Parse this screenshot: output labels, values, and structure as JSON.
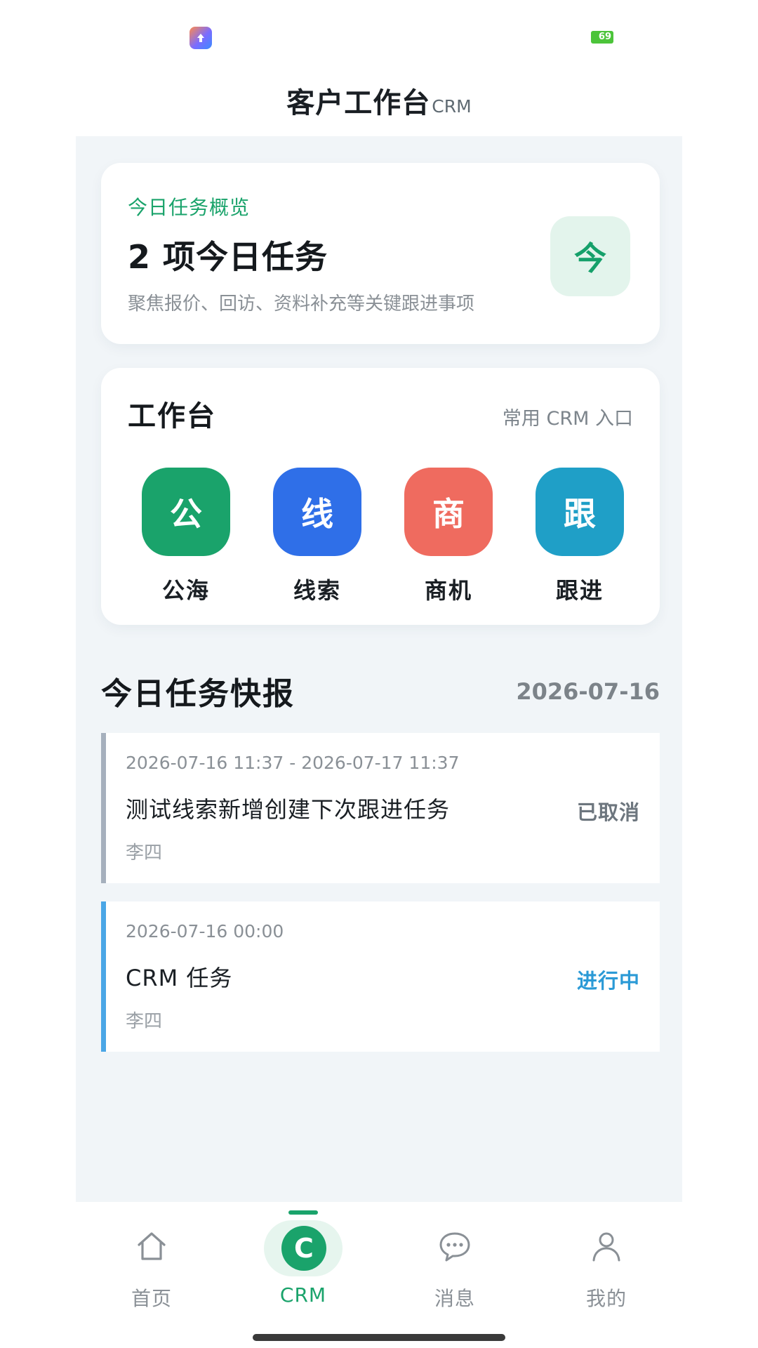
{
  "status_bar": {
    "app_icon": "upload-arrow-icon",
    "battery_level": "69"
  },
  "header": {
    "title": "客户工作台",
    "suffix": "CRM"
  },
  "overview": {
    "kicker": "今日任务概览",
    "title": "2 项今日任务",
    "description": "聚焦报价、回访、资料补充等关键跟进事项",
    "badge": "今",
    "badge_color": "#15a06a"
  },
  "workbench": {
    "title": "工作台",
    "hint": "常用 CRM 入口",
    "entries": [
      {
        "icon_char": "公",
        "label": "公海",
        "color": "#1aa36b"
      },
      {
        "icon_char": "线",
        "label": "线索",
        "color": "#2f6fe8"
      },
      {
        "icon_char": "商",
        "label": "商机",
        "color": "#ef6b5f"
      },
      {
        "icon_char": "跟",
        "label": "跟进",
        "color": "#1f9fc7"
      }
    ]
  },
  "brief": {
    "title": "今日任务快报",
    "date": "2026-07-16",
    "tasks": [
      {
        "time": "2026-07-16 11:37 - 2026-07-17 11:37",
        "title": "测试线索新增创建下次跟进任务",
        "owner": "李四",
        "status": "已取消",
        "status_color": "#6d767e",
        "accent_color": "#a6b0bd"
      },
      {
        "time": "2026-07-16 00:00",
        "title": "CRM 任务",
        "owner": "李四",
        "status": "进行中",
        "status_color": "#2b9ad6",
        "accent_color": "#4aa6e6"
      }
    ]
  },
  "bottom_nav": {
    "active": "CRM",
    "items": [
      {
        "label": "首页",
        "icon": "home-icon"
      },
      {
        "label": "CRM",
        "icon": "crm-icon",
        "icon_char": "C"
      },
      {
        "label": "消息",
        "icon": "chat-bubble-icon"
      },
      {
        "label": "我的",
        "icon": "user-icon"
      }
    ],
    "active_color": "#1aa36b"
  }
}
